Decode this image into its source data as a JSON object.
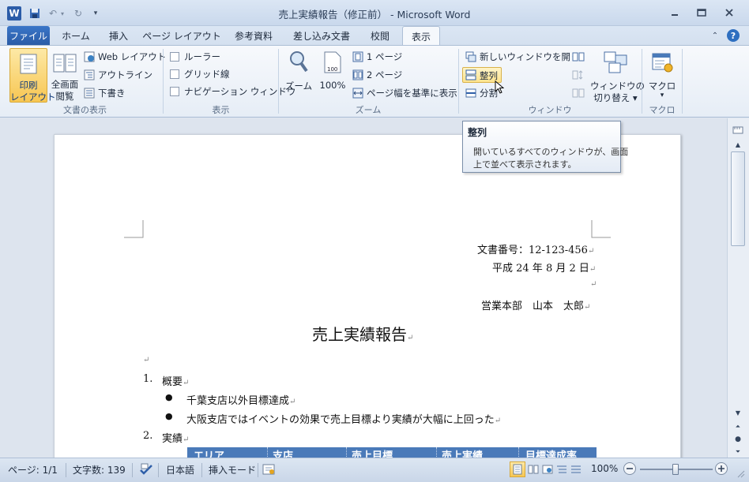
{
  "window": {
    "title": "売上実績報告（修正前） - Microsoft Word"
  },
  "qat": {
    "word_icon": "W",
    "save_icon": "save-icon",
    "undo_icon": "undo-icon",
    "redo_icon": "redo-icon",
    "customize_icon": "customize-icon"
  },
  "window_controls": {
    "minimize": "▭",
    "restore": "▣",
    "close": "✕"
  },
  "tabs": [
    {
      "label": "ファイル"
    },
    {
      "label": "ホーム"
    },
    {
      "label": "挿入"
    },
    {
      "label": "ページ レイアウト"
    },
    {
      "label": "参考資料"
    },
    {
      "label": "差し込み文書"
    },
    {
      "label": "校閲"
    },
    {
      "label": "表示"
    }
  ],
  "ribbon": {
    "views_group": {
      "label": "文書の表示",
      "print_layout": "印刷\nレイアウト",
      "print_layout_l1": "印刷",
      "print_layout_l2": "レイアウト",
      "full_screen_l1": "全画面",
      "full_screen_l2": "閲覧",
      "web_layout": "Web レイアウト",
      "outline": "アウトライン",
      "draft": "下書き"
    },
    "show_group": {
      "label": "表示",
      "ruler": "ルーラー",
      "gridlines": "グリッド線",
      "navigation": "ナビゲーション ウィンドウ"
    },
    "zoom_group": {
      "label": "ズーム",
      "zoom": "ズーム",
      "hundred": "100%",
      "one_page": "1 ページ",
      "two_pages": "2 ページ",
      "page_width": "ページ幅を基準に表示"
    },
    "window_group": {
      "label": "ウィンドウ",
      "new_window": "新しいウィンドウを開く",
      "arrange_all": "整列",
      "split": "分割",
      "switch_l1": "ウィンドウの",
      "switch_l2": "切り替え ▾"
    },
    "macro_group": {
      "label": "マクロ",
      "macros": "マクロ",
      "arrow": "▾"
    }
  },
  "tooltip": {
    "title": "整列",
    "body_l1": "開いているすべてのウィンドウが、画面",
    "body_l2": "上で並べて表示されます。"
  },
  "document": {
    "doc_number": "文書番号：12-123-456",
    "date": "平成 24 年 8 月 2 日",
    "author": "営業本部　山本　太郎",
    "title": "売上実績報告",
    "item1_num": "1.",
    "item1": "概要",
    "bullet1": "千葉支店以外目標達成",
    "bullet2": "大阪支店ではイベントの効果で売上目標より実績が大幅に上回った",
    "item2_num": "2.",
    "item2": "実績",
    "table_headers": [
      "エリア",
      "支店",
      "売上目標",
      "売上実績",
      "目標達成率"
    ],
    "para_mark": "↵",
    "bullet_char": "●"
  },
  "status": {
    "page": "ページ: 1/1",
    "words": "文字数: 139",
    "language": "日本語",
    "mode": "挿入モード",
    "zoom": "100%",
    "zoom_value": 100
  },
  "colors": {
    "accent": "#2a5ba6",
    "table_header": "#4a7ab9",
    "highlight": "#fde68a"
  }
}
